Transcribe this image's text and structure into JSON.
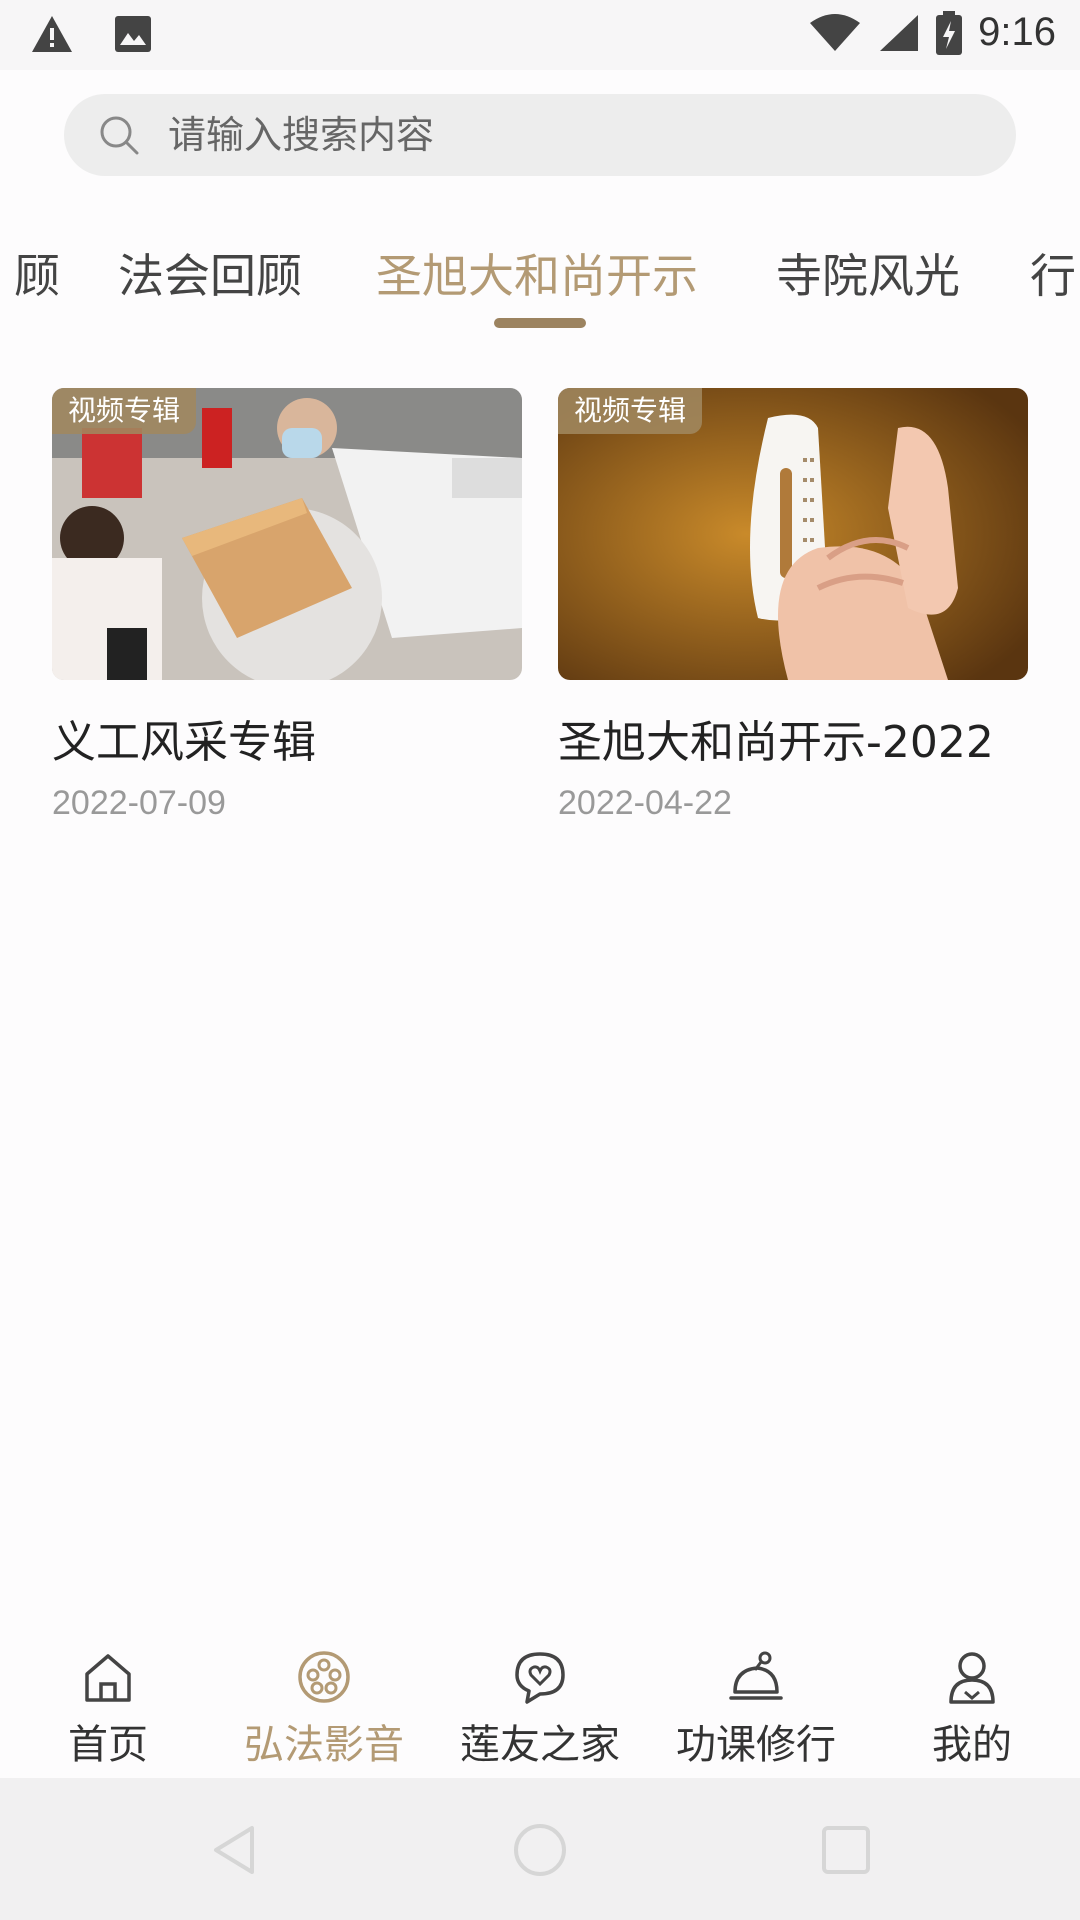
{
  "status_bar": {
    "time": "9:16",
    "icons": [
      "warning-icon",
      "image-icon",
      "wifi-icon",
      "signal-icon",
      "battery-charging-icon"
    ]
  },
  "search": {
    "placeholder": "请输入搜索内容",
    "value": ""
  },
  "tabs": [
    {
      "label": "顾",
      "active": false
    },
    {
      "label": "法会回顾",
      "active": false
    },
    {
      "label": "圣旭大和尚开示",
      "active": true
    },
    {
      "label": "寺院风光",
      "active": false
    },
    {
      "label": "行",
      "active": false
    }
  ],
  "cards": [
    {
      "badge": "视频专辑",
      "title": "义工风采专辑",
      "date": "2022-07-09",
      "image": "volunteers-carrying-box-photo"
    },
    {
      "badge": "视频专辑",
      "title": "圣旭大和尚开示-2022",
      "date": "2022-04-22",
      "image": "hand-holding-teacup-photo"
    }
  ],
  "bottom_nav": [
    {
      "label": "首页",
      "icon": "home-icon",
      "active": false
    },
    {
      "label": "弘法影音",
      "icon": "film-reel-icon",
      "active": true
    },
    {
      "label": "莲友之家",
      "icon": "heart-chat-icon",
      "active": false
    },
    {
      "label": "功课修行",
      "icon": "bell-meditation-icon",
      "active": false
    },
    {
      "label": "我的",
      "icon": "person-icon",
      "active": false
    }
  ],
  "colors": {
    "accent": "#b39a74",
    "indicator": "#9c8360",
    "text_primary": "#222222",
    "text_secondary": "#999999"
  }
}
